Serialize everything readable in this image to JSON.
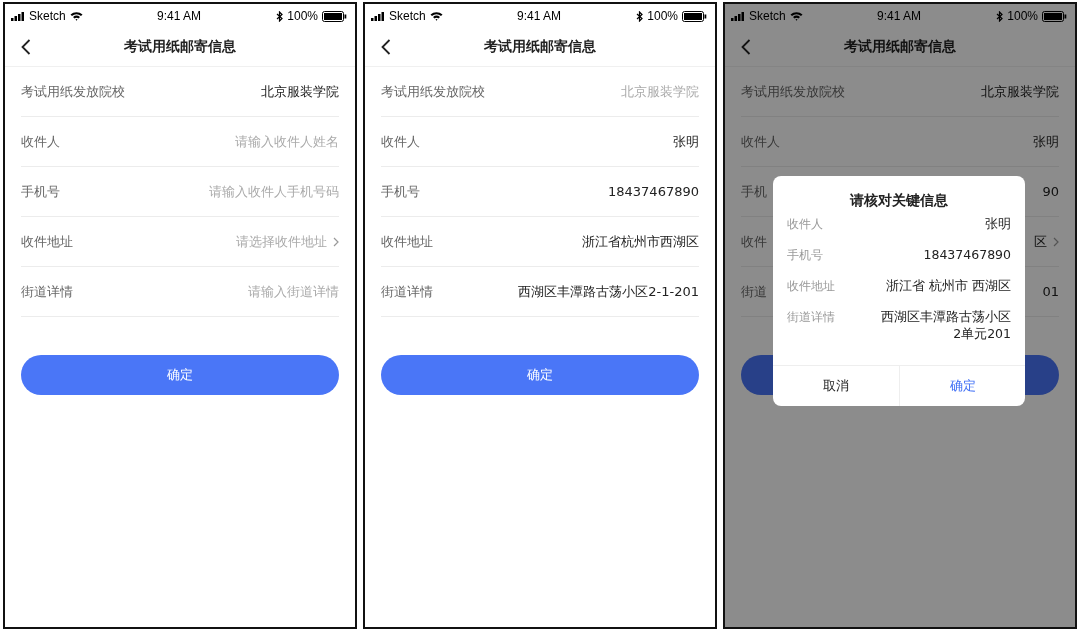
{
  "screens": [
    {
      "status_bar": {
        "carrier": "Sketch",
        "time": "9:41 AM",
        "battery": "100%"
      },
      "nav_title": "考试用纸邮寄信息",
      "fields": [
        {
          "label": "考试用纸发放院校",
          "value": "北京服装学院",
          "readonly": false,
          "chevron": false
        },
        {
          "label": "收件人",
          "placeholder": "请输入收件人姓名",
          "chevron": false
        },
        {
          "label": "手机号",
          "placeholder": "请输入收件人手机号码",
          "chevron": false
        },
        {
          "label": "收件地址",
          "placeholder": "请选择收件地址",
          "chevron": true
        },
        {
          "label": "街道详情",
          "placeholder": "请输入街道详情",
          "chevron": false
        }
      ],
      "submit_button": "确定"
    },
    {
      "status_bar": {
        "carrier": "Sketch",
        "time": "9:41 AM",
        "battery": "100%"
      },
      "nav_title": "考试用纸邮寄信息",
      "fields": [
        {
          "label": "考试用纸发放院校",
          "value": "北京服装学院",
          "readonly": true,
          "chevron": false
        },
        {
          "label": "收件人",
          "value": "张明",
          "readonly": false,
          "chevron": false
        },
        {
          "label": "手机号",
          "value": "18437467890",
          "readonly": false,
          "chevron": false
        },
        {
          "label": "收件地址",
          "value": "浙江省杭州市西湖区",
          "readonly": false,
          "chevron": false
        },
        {
          "label": "街道详情",
          "value": "西湖区丰潭路古荡小区2-1-201",
          "readonly": false,
          "chevron": false
        }
      ],
      "submit_button": "确定"
    },
    {
      "status_bar": {
        "carrier": "Sketch",
        "time": "9:41 AM",
        "battery": "100%"
      },
      "nav_title": "考试用纸邮寄信息",
      "fields": [
        {
          "label": "考试用纸发放院校",
          "value": "北京服装学院",
          "readonly": false,
          "chevron": false
        },
        {
          "label": "收件人",
          "value": "张明",
          "readonly": false,
          "chevron": false
        },
        {
          "label": "手机",
          "value": "90",
          "readonly": false,
          "chevron": false
        },
        {
          "label": "收件",
          "value": "区",
          "readonly": false,
          "chevron": true
        },
        {
          "label": "街道",
          "value": "01",
          "readonly": false,
          "chevron": false
        }
      ],
      "dialog": {
        "title": "请核对关键信息",
        "rows": [
          {
            "label": "收件人",
            "value": "张明"
          },
          {
            "label": "手机号",
            "value": "18437467890"
          },
          {
            "label": "收件地址",
            "value": "浙江省 杭州市 西湖区"
          },
          {
            "label": "街道详情",
            "value": "西湖区丰潭路古荡小区2单元201"
          }
        ],
        "buttons": [
          {
            "label": "取消",
            "primary": false
          },
          {
            "label": "确定",
            "primary": true
          }
        ]
      }
    }
  ]
}
